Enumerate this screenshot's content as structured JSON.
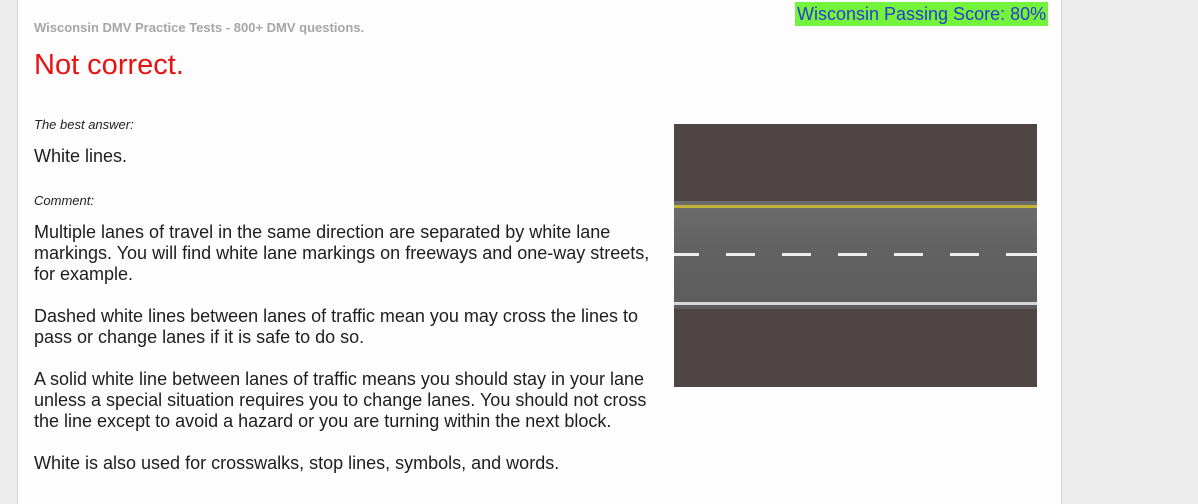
{
  "header": {
    "site_title": "Wisconsin DMV Practice Tests - 800+ DMV questions.",
    "passing_score": "Wisconsin Passing Score: 80%"
  },
  "result": {
    "status": "Not correct."
  },
  "answer": {
    "label": "The best answer:",
    "text": "White lines."
  },
  "comment": {
    "label": "Comment:",
    "paragraphs": [
      "Multiple lanes of travel in the same direction are separated by white lane markings. You will find white lane markings on freeways and one-way streets, for example.",
      "Dashed white lines between lanes of traffic mean you may cross the lines to pass or change lanes if it is safe to do so.",
      "A solid white line between lanes of traffic means you should stay in your lane unless a special situation requires you to change lanes. You should not cross the line except to avoid a hazard or you are turning within the next block.",
      "White is also used for crosswalks, stop lines, symbols, and words."
    ]
  },
  "colors": {
    "result": "#e81212",
    "score_background": "#74f33c",
    "score_text": "#2a3ccf"
  }
}
